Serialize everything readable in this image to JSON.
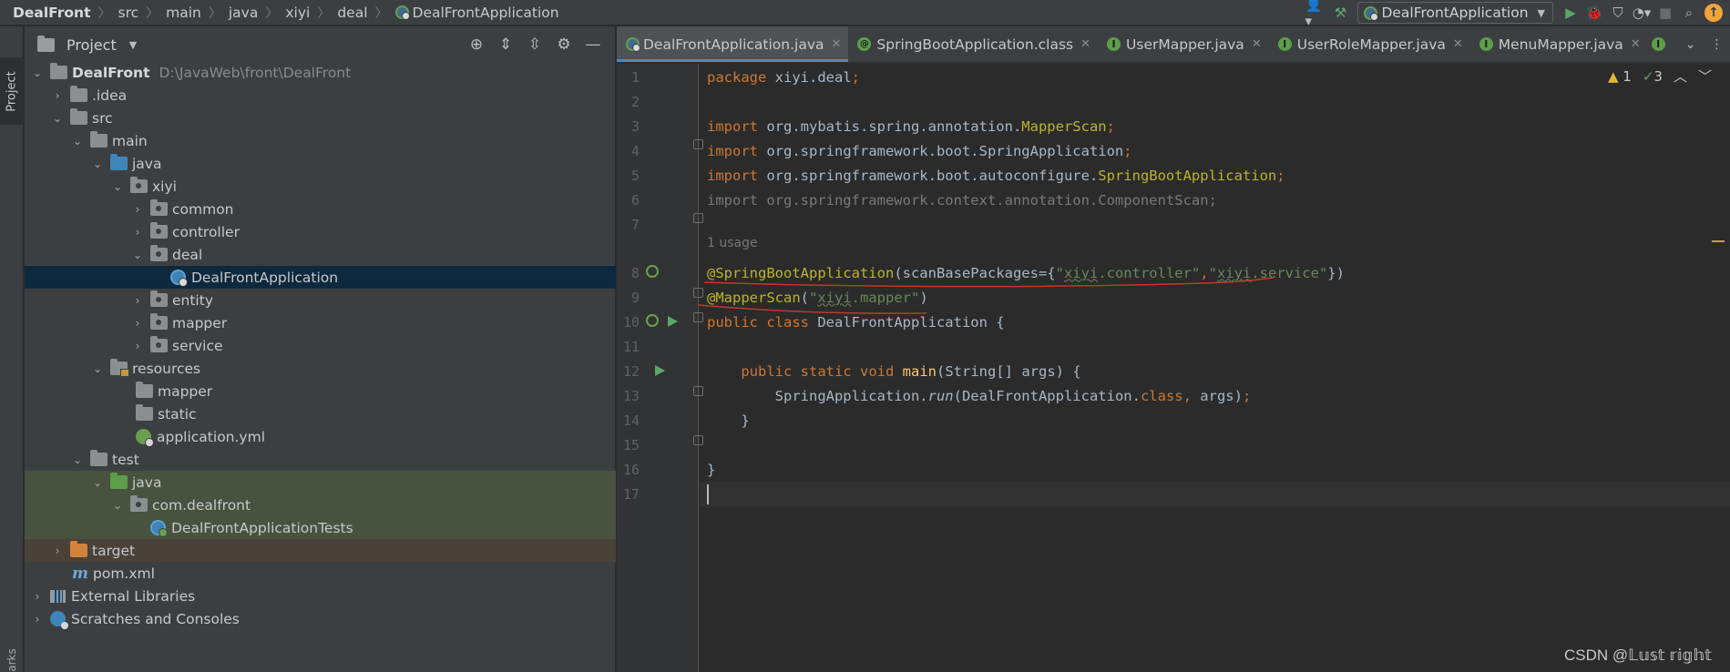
{
  "breadcrumbs": [
    "DealFront",
    "src",
    "main",
    "java",
    "xiyi",
    "deal",
    "DealFrontApplication"
  ],
  "run_config": "DealFrontApplication",
  "colors": {
    "accent": "#4a88c7",
    "run_green": "#59a869",
    "selection": "#0d293e",
    "warning": "#e8b339",
    "annotation_markup": "#c0392b"
  },
  "sidebar": {
    "stripe_project_label": "Project",
    "stripe_bottom_label": "arks"
  },
  "project_panel": {
    "title": "Project",
    "tree": [
      {
        "label": "DealFront",
        "path": "D:\\JavaWeb\\front\\DealFront"
      },
      {
        "label": ".idea"
      },
      {
        "label": "src"
      },
      {
        "label": "main"
      },
      {
        "label": "java"
      },
      {
        "label": "xiyi"
      },
      {
        "label": "common"
      },
      {
        "label": "controller"
      },
      {
        "label": "deal"
      },
      {
        "label": "DealFrontApplication"
      },
      {
        "label": "entity"
      },
      {
        "label": "mapper"
      },
      {
        "label": "service"
      },
      {
        "label": "resources"
      },
      {
        "label": "mapper"
      },
      {
        "label": "static"
      },
      {
        "label": "application.yml"
      },
      {
        "label": "test"
      },
      {
        "label": "java"
      },
      {
        "label": "com.dealfront"
      },
      {
        "label": "DealFrontApplicationTests"
      },
      {
        "label": "target"
      },
      {
        "label": "pom.xml"
      },
      {
        "label": "External Libraries"
      },
      {
        "label": "Scratches and Consoles"
      }
    ]
  },
  "tabs": [
    {
      "label": "DealFrontApplication.java",
      "active": true
    },
    {
      "label": "SpringBootApplication.class"
    },
    {
      "label": "UserMapper.java"
    },
    {
      "label": "UserRoleMapper.java"
    },
    {
      "label": "MenuMapper.java"
    }
  ],
  "inspections": {
    "warnings": "1",
    "weak_warnings": "3"
  },
  "editor": {
    "line_numbers": [
      "1",
      "2",
      "3",
      "4",
      "5",
      "6",
      "7",
      "8",
      "9",
      "10",
      "11",
      "12",
      "13",
      "14",
      "15",
      "16",
      "17"
    ],
    "usage_hint": "1 usage",
    "code": {
      "l1_kw": "package",
      "l1_rest": " xiyi.deal",
      "l1_semi": ";",
      "import_kw": "import",
      "l3_pkg": " org.mybatis.spring.annotation.",
      "l3_cls": "MapperScan",
      "l3_semi": ";",
      "l4_pkg": " org.springframework.boot.SpringApplication",
      "l4_semi": ";",
      "l5_pkg": " org.springframework.boot.autoconfigure.",
      "l5_cls": "SpringBootApplication",
      "l5_semi": ";",
      "l6_text": "import org.springframework.context.annotation.ComponentScan;",
      "l8_ann": "@SpringBootApplication",
      "l8_a": "(scanBasePackages={",
      "l8_q1": "\"",
      "l8_xiyi1": "xiyi",
      "l8_s1": ".controller\"",
      "l8_comma": ",",
      "l8_q2": "\"",
      "l8_xiyi2": "xiyi",
      "l8_s2": ".service\"",
      "l8_end": "})",
      "l9_ann": "@MapperScan",
      "l9_a": "(",
      "l9_q": "\"",
      "l9_xiyi": "xiyi",
      "l9_s": ".mapper\"",
      "l9_end": ")",
      "l10_public": "public",
      "l10_class": " class",
      "l10_rest": " DealFrontApplication {",
      "l12_indent": "    ",
      "l12_public": "public",
      "l12_static": " static",
      "l12_void": " void",
      "l12_main": " main",
      "l12_rest": "(String[] args) {",
      "l13_indent": "        ",
      "l13_cls": "SpringApplication.",
      "l13_run": "run",
      "l13_a": "(DealFrontApplication.",
      "l13_class": "class",
      "l13_comma": ",",
      "l13_rest": " args)",
      "l13_semi": ";",
      "l14_text": "    }",
      "l16_text": "}"
    }
  },
  "watermark": "CSDN @𝕃𝕦𝕤𝕥 𝕣𝕚𝕘𝕙𝕥"
}
